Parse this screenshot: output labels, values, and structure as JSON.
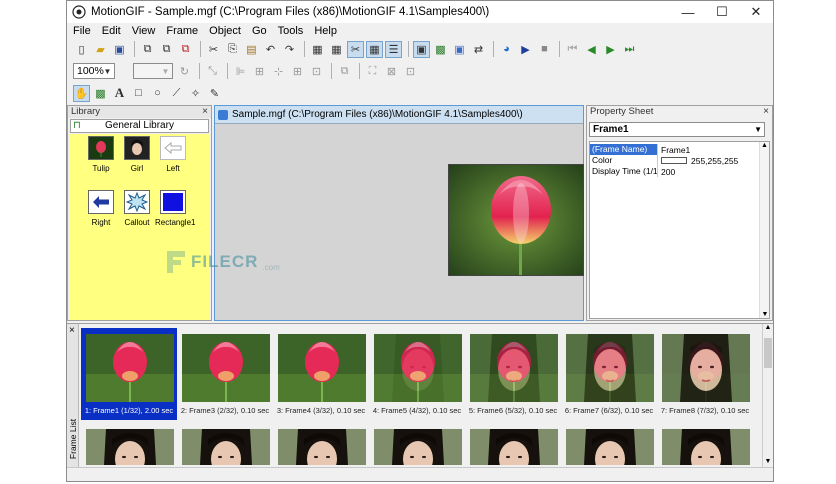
{
  "window": {
    "title": "MotionGIF - Sample.mgf (C:\\Program Files (x86)\\MotionGIF 4.1\\Samples400\\)",
    "minimize": "—",
    "maximize": "☐",
    "close": "✕"
  },
  "menu": [
    "File",
    "Edit",
    "View",
    "Frame",
    "Object",
    "Go",
    "Tools",
    "Help"
  ],
  "toolbar": {
    "zoom": "100%"
  },
  "library": {
    "header": "Library",
    "close": "×",
    "tab": "General Library",
    "items": [
      {
        "label": "Tulip"
      },
      {
        "label": "Girl"
      },
      {
        "label": "Left"
      },
      {
        "label": "Right"
      },
      {
        "label": "Callout"
      },
      {
        "label": "Rectangle1"
      }
    ]
  },
  "document": {
    "title": "Sample.mgf (C:\\Program Files (x86)\\MotionGIF 4.1\\Samples400\\)"
  },
  "property_sheet": {
    "header": "Property Sheet",
    "close": "×",
    "selected": "Frame1",
    "rows": [
      {
        "key": "(Frame Name)",
        "value": "Frame1"
      },
      {
        "key": "Color",
        "value": "255,255,255"
      },
      {
        "key": "Display Time (1/10",
        "value": "200"
      }
    ]
  },
  "frame_list": {
    "label": "Frame List",
    "close": "×",
    "frames": [
      {
        "caption": "1: Frame1 (1/32), 2.00 sec",
        "selected": true
      },
      {
        "caption": "2: Frame3 (2/32), 0.10 sec",
        "selected": false
      },
      {
        "caption": "3: Frame4 (3/32), 0.10 sec",
        "selected": false
      },
      {
        "caption": "4: Frame5 (4/32), 0.10 sec",
        "selected": false
      },
      {
        "caption": "5: Frame6 (5/32), 0.10 sec",
        "selected": false
      },
      {
        "caption": "6: Frame7 (6/32), 0.10 sec",
        "selected": false
      },
      {
        "caption": "7: Frame8 (7/32), 0.10 sec",
        "selected": false
      }
    ]
  },
  "watermark": {
    "name": "FILECR",
    "suffix": ".com"
  }
}
